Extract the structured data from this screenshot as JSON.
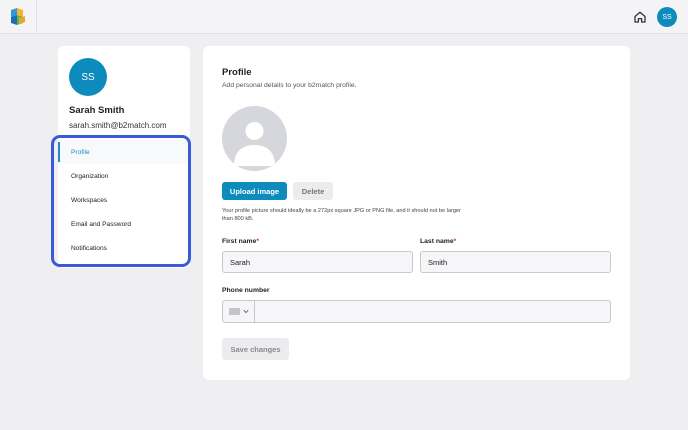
{
  "header": {
    "user_initials": "SS",
    "icons": {
      "logo": "b2match-logo-icon",
      "home": "home-icon"
    }
  },
  "sidebar": {
    "avatar_initials": "SS",
    "name": "Sarah Smith",
    "email": "sarah.smith@b2match.com",
    "items": [
      {
        "label": "Profile",
        "active": true
      },
      {
        "label": "Organization",
        "active": false
      },
      {
        "label": "Workspaces",
        "active": false
      },
      {
        "label": "Email and Password",
        "active": false
      },
      {
        "label": "Notifications",
        "active": false
      }
    ]
  },
  "main": {
    "title": "Profile",
    "subtitle": "Add personal details to your b2match profile.",
    "upload_label": "Upload image",
    "delete_label": "Delete",
    "hint": "Your profile picture should ideally be a 272px square JPG or PNG file, and it should not be larger than 800 kB.",
    "first_name": {
      "label": "First name",
      "required_mark": "*",
      "value": "Sarah"
    },
    "last_name": {
      "label": "Last name",
      "required_mark": "*",
      "value": "Smith"
    },
    "phone": {
      "label": "Phone number",
      "value": ""
    },
    "save_label": "Save changes"
  },
  "colors": {
    "accent": "#0e8bbd",
    "highlight": "#3a5bd9",
    "required": "#d0312d"
  }
}
